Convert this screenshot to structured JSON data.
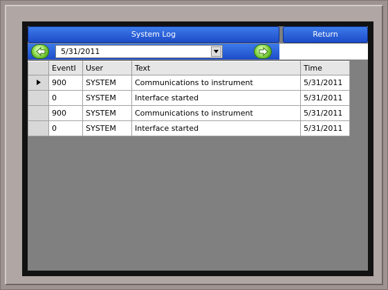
{
  "header": {
    "title": "System Log",
    "return_label": "Return"
  },
  "navigation": {
    "date": "5/31/2011",
    "prev_icon": "green-left-arrow-icon",
    "next_icon": "green-right-arrow-icon",
    "dropdown_icon": "chevron-down-icon"
  },
  "table": {
    "columns": [
      "EventI",
      "User",
      "Text",
      "Time"
    ],
    "selected_row": 0,
    "rows": [
      {
        "event": "900",
        "user": "SYSTEM",
        "text": "Communications to instrument",
        "time": "5/31/2011"
      },
      {
        "event": "0",
        "user": "SYSTEM",
        "text": "Interface started",
        "time": "5/31/2011"
      },
      {
        "event": "900",
        "user": "SYSTEM",
        "text": "Communications to instrument",
        "time": "5/31/2011"
      },
      {
        "event": "0",
        "user": "SYSTEM",
        "text": "Interface started",
        "time": "5/31/2011"
      }
    ]
  }
}
